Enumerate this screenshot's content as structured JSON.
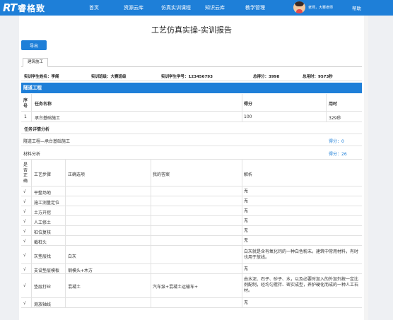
{
  "nav": {
    "logo_rt": "RT",
    "logo_cn": "睿格致",
    "items": [
      "首页",
      "资源云库",
      "仿真实训课程",
      "知识云库",
      "教学管理"
    ],
    "user": "老师，大赛老师",
    "help": "帮助"
  },
  "page": {
    "title": "工艺仿真实操-实训报告",
    "export_label": "导出",
    "tab": "建筑施工"
  },
  "info": {
    "student_name": "实训学生姓名：李阁",
    "class": "实训班级：大赛班级",
    "student_id": "实训学生学号：123456793",
    "total_score": "总得分：3998",
    "total_time": "总用时：9573秒"
  },
  "section_title": "隧道工程",
  "task_table": {
    "headers": [
      "序号",
      "任务名称",
      "得分",
      "用时"
    ],
    "rows": [
      [
        "1",
        "承台基础施工",
        "100",
        "329秒"
      ]
    ]
  },
  "detail": {
    "heading": "任务详情分析",
    "subtask": "隧道工程—承台基础施工",
    "subtask_score": "得分：0",
    "material": "材料分析",
    "material_score": "得分：26"
  },
  "step_table": {
    "headers": [
      "是否正确",
      "工艺步骤",
      "正确选项",
      "我的答案",
      "解析"
    ],
    "rows": [
      [
        "√",
        "平整场地",
        "",
        "",
        "无"
      ],
      [
        "√",
        "施工测量定位",
        "",
        "",
        "无"
      ],
      [
        "√",
        "土方开挖",
        "",
        "",
        "无"
      ],
      [
        "√",
        "人工修土",
        "",
        "",
        "无"
      ],
      [
        "√",
        "桩位复核",
        "",
        "",
        "无"
      ],
      [
        "√",
        "截桩头",
        "",
        "",
        "无"
      ],
      [
        "√",
        "灰垫层找",
        "白灰",
        "",
        "白灰就是含有氧化钙的一种白色粉末。建筑中常用材料，有时也用于放线。"
      ],
      [
        "√",
        "支设垫层模板",
        "钢模头+木方",
        "",
        "无"
      ],
      [
        "√",
        "垫层打砼",
        "混凝土",
        "汽车泵+混凝土运输车+",
        "由水泥、石子、砂子、水，以及必要时加入的外加剂按一定比例配制，经均匀搅拌、密实成型，养护硬化而成的一种人工石材。"
      ],
      [
        "√",
        "测放轴线",
        "",
        "",
        "无"
      ]
    ]
  }
}
